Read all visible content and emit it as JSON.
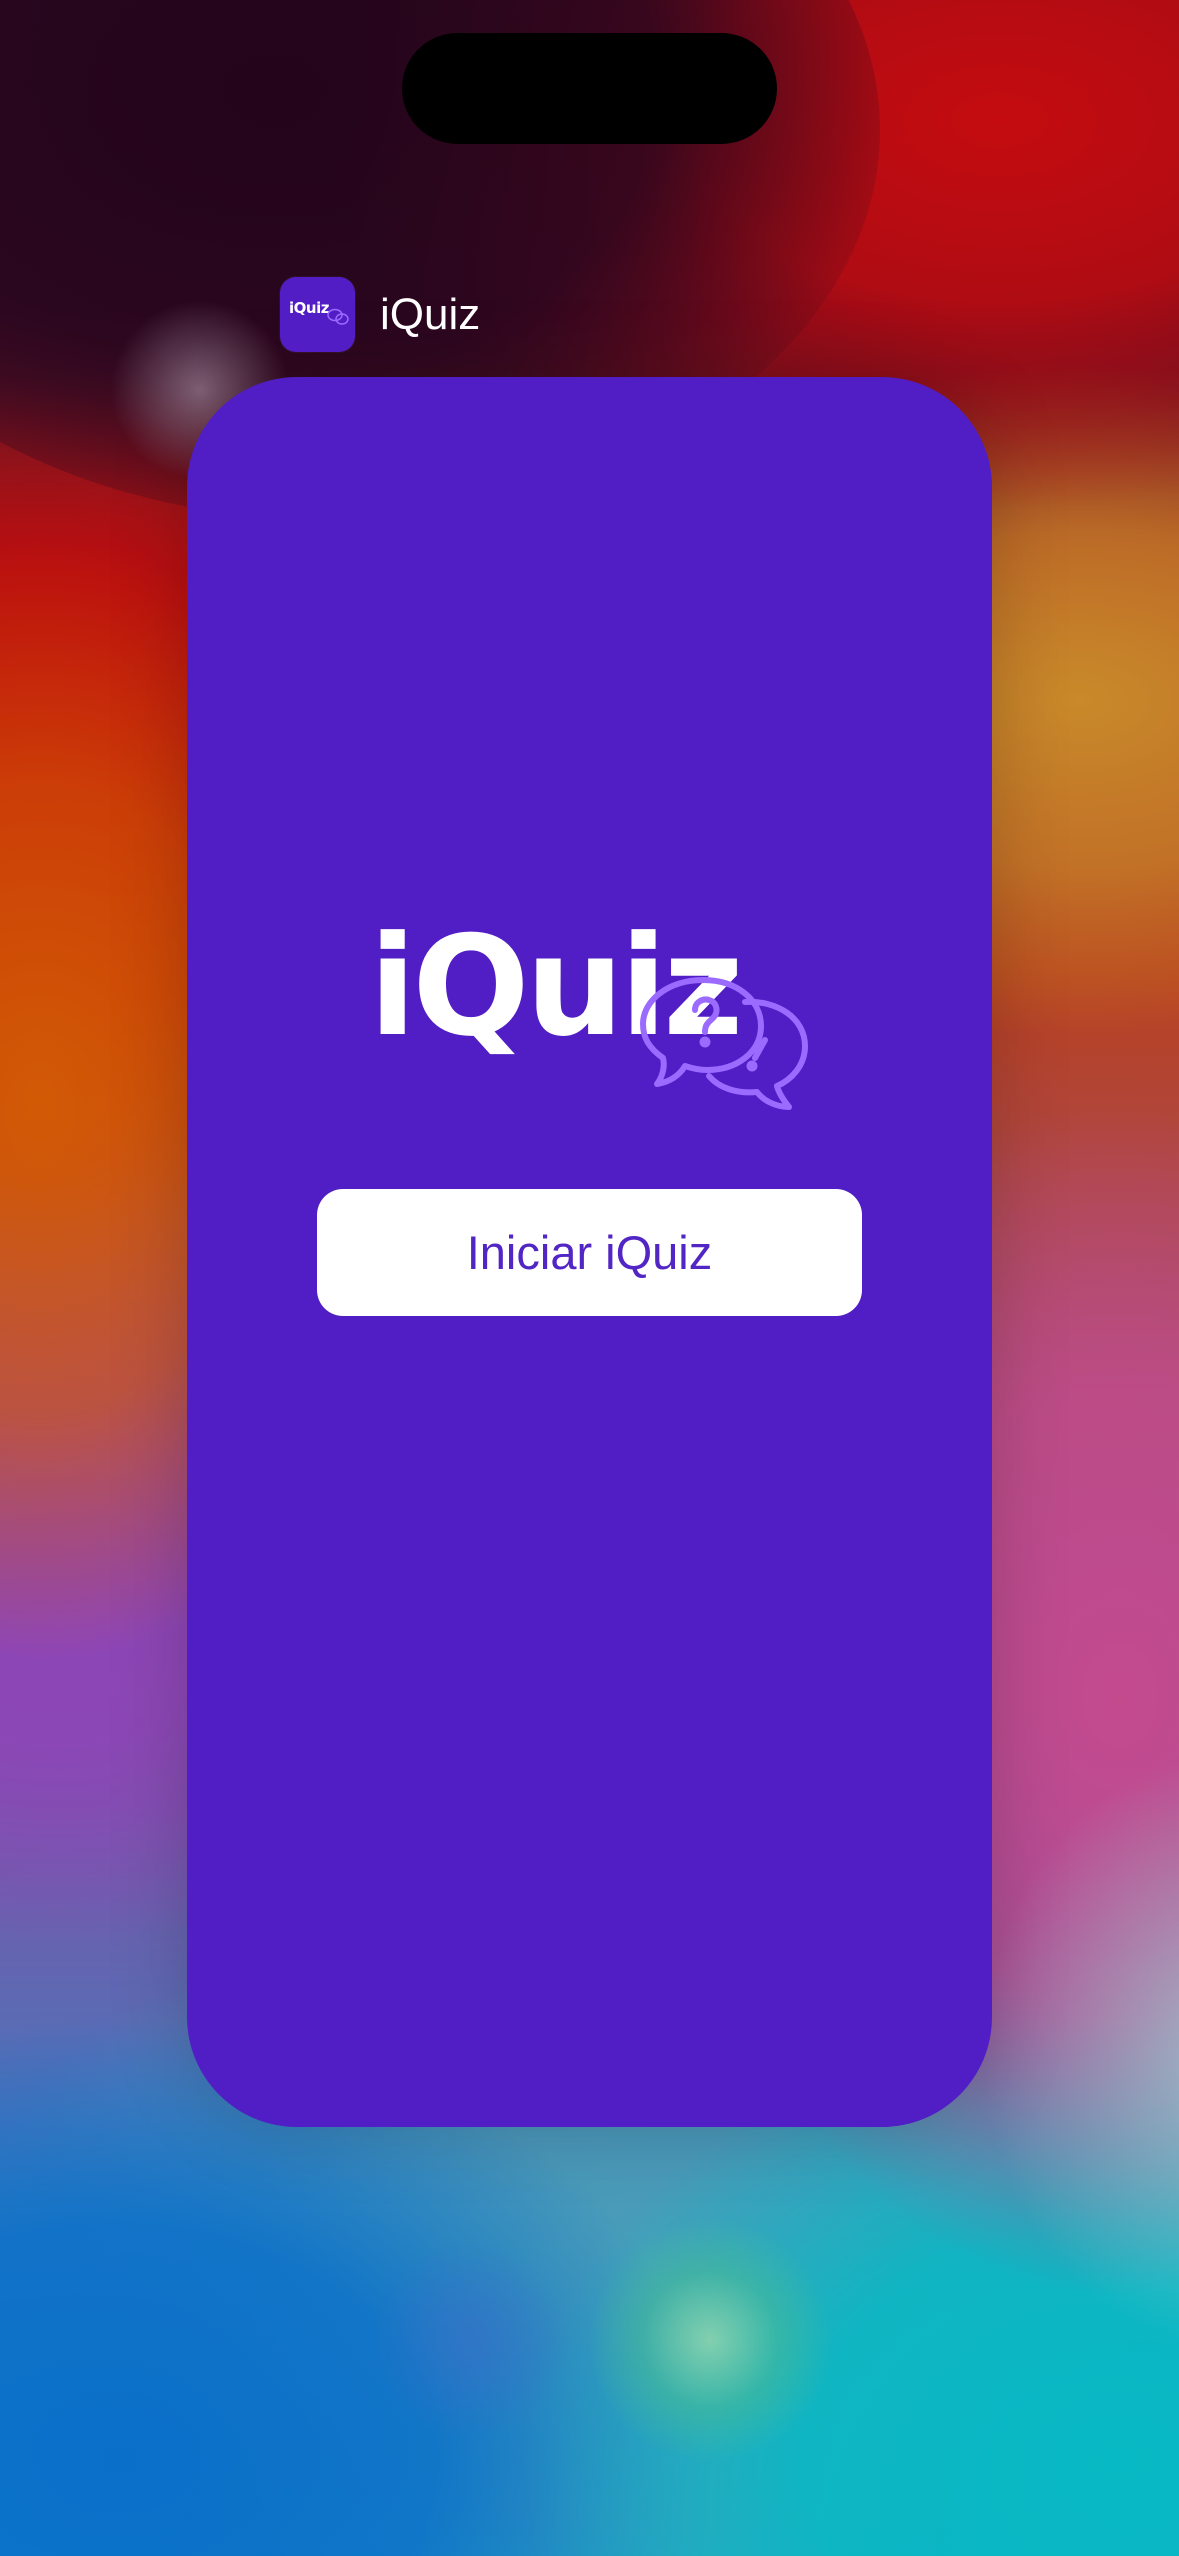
{
  "app_switcher": {
    "app_name": "iQuiz",
    "app_icon": {
      "label": "iQuiz",
      "icon": "chat-bubbles-icon",
      "background": "#521dc5"
    }
  },
  "app_screen": {
    "background": "#511dc5",
    "logo": {
      "text": "iQuiz",
      "icon": "question-exclamation-chat-bubbles-icon",
      "icon_color": "#9b6bff"
    },
    "start_button": {
      "label": "Iniciar iQuiz",
      "text_color": "#5225c5",
      "background": "#ffffff"
    }
  }
}
